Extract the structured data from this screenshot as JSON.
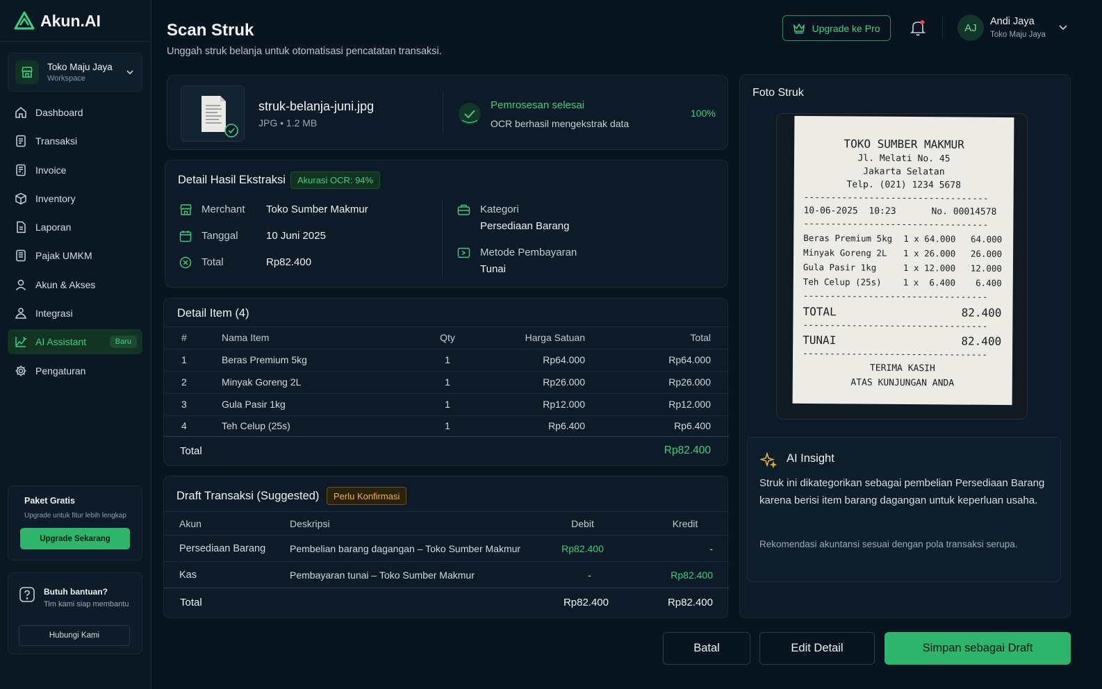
{
  "brand": {
    "name": "Akun.AI"
  },
  "workspace": {
    "name": "Toko Maju Jaya",
    "label": "Workspace"
  },
  "nav": [
    {
      "label": "Dashboard",
      "icon": "home-icon"
    },
    {
      "label": "Transaksi",
      "icon": "document-icon"
    },
    {
      "label": "Invoice",
      "icon": "invoice-icon"
    },
    {
      "label": "Inventory",
      "icon": "box-icon"
    },
    {
      "label": "Laporan",
      "icon": "report-icon"
    },
    {
      "label": "Pajak UMKM",
      "icon": "tax-icon"
    },
    {
      "label": "Akun & Akses",
      "icon": "user-icon"
    },
    {
      "label": "Integrasi",
      "icon": "integration-icon"
    },
    {
      "label": "AI Assistant",
      "icon": "ai-icon",
      "badge": "Baru",
      "active": true
    },
    {
      "label": "Pengaturan",
      "icon": "gear-icon"
    }
  ],
  "plan": {
    "title": "Paket Gratis",
    "subtitle": "Upgrade untuk fitur lebih lengkap",
    "button": "Upgrade Sekarang"
  },
  "help": {
    "title": "Butuh bantuan?",
    "subtitle": "Tim kami siap membantu",
    "button": "Hubungi Kami"
  },
  "header": {
    "title": "Scan Struk",
    "subtitle": "Unggah struk belanja untuk otomatisasi pencatatan transaksi.",
    "upgrade": "Upgrade ke Pro",
    "user": {
      "initials": "AJ",
      "name": "Andi Jaya",
      "store": "Toko Maju Jaya"
    }
  },
  "file": {
    "name": "struk-belanja-juni.jpg",
    "meta": "JPG • 1.2 MB",
    "status": "Pemrosesan selesai",
    "status_detail": "OCR berhasil mengekstrak data",
    "progress": "100%"
  },
  "extraction": {
    "title": "Detail Hasil Ekstraksi",
    "accuracy": "Akurasi OCR: 94%",
    "merchant_label": "Merchant",
    "merchant": "Toko Sumber Makmur",
    "date_label": "Tanggal",
    "date": "10 Juni 2025",
    "total_label": "Total",
    "total": "Rp82.400",
    "category_label": "Kategori",
    "category": "Persediaan Barang",
    "payment_label": "Metode Pembayaran",
    "payment": "Tunai"
  },
  "items": {
    "title": "Detail Item (4)",
    "headers": [
      "#",
      "Nama Item",
      "Qty",
      "Harga Satuan",
      "Total"
    ],
    "rows": [
      [
        "1",
        "Beras Premium 5kg",
        "1",
        "Rp64.000",
        "Rp64.000"
      ],
      [
        "2",
        "Minyak Goreng 2L",
        "1",
        "Rp26.000",
        "Rp26.000"
      ],
      [
        "3",
        "Gula Pasir 1kg",
        "1",
        "Rp12.000",
        "Rp12.000"
      ],
      [
        "4",
        "Teh Celup (25s)",
        "1",
        "Rp6.400",
        "Rp6.400"
      ]
    ],
    "total_label": "Total",
    "total": "Rp82.400"
  },
  "draft": {
    "title": "Draft Transaksi (Suggested)",
    "badge": "Perlu Konfirmasi",
    "headers": [
      "Akun",
      "Deskripsi",
      "Debit",
      "Kredit"
    ],
    "rows": [
      [
        "Persediaan Barang",
        "Pembelian barang dagangan – Toko Sumber Makmur",
        "Rp82.400",
        "-"
      ],
      [
        "Kas",
        "Pembayaran tunai – Toko Sumber Makmur",
        "-",
        "Rp82.400"
      ]
    ],
    "total_label": "Total",
    "total_debit": "Rp82.400",
    "total_credit": "Rp82.400"
  },
  "photo": {
    "title": "Foto Struk",
    "receipt": {
      "store": "TOKO SUMBER MAKMUR",
      "address1": "Jl. Melati No. 45",
      "address2": "Jakarta Selatan",
      "phone": "Telp. (021) 1234 5678",
      "datetime": "10-06-2025  10:23",
      "number": "No. 00014578",
      "lines": [
        [
          "Beras Premium 5kg",
          "1 x 64.000",
          "64.000"
        ],
        [
          "Minyak Goreng 2L",
          "1 x 26.000",
          "26.000"
        ],
        [
          "Gula Pasir 1kg",
          "1 x 12.000",
          "12.000"
        ],
        [
          "Teh Celup (25s)",
          "1 x  6.400",
          "6.400"
        ]
      ],
      "total_label": "TOTAL",
      "total": "82.400",
      "cash_label": "TUNAI",
      "cash": "82.400",
      "thanks1": "TERIMA KASIH",
      "thanks2": "ATAS KUNJUNGAN ANDA",
      "dashes": "----------------------------------"
    }
  },
  "insight": {
    "title": "AI Insight",
    "body": "Struk ini dikategorikan sebagai pembelian Persediaan Barang karena berisi item barang dagangan untuk keperluan usaha.",
    "note": "Rekomendasi akuntansi sesuai dengan pola transaksi serupa."
  },
  "actions": {
    "cancel": "Batal",
    "edit": "Edit Detail",
    "save": "Simpan sebagai Draft"
  },
  "colors": {
    "accent": "#3ecf7e",
    "warning": "#f0b440",
    "background": "#08141f"
  }
}
